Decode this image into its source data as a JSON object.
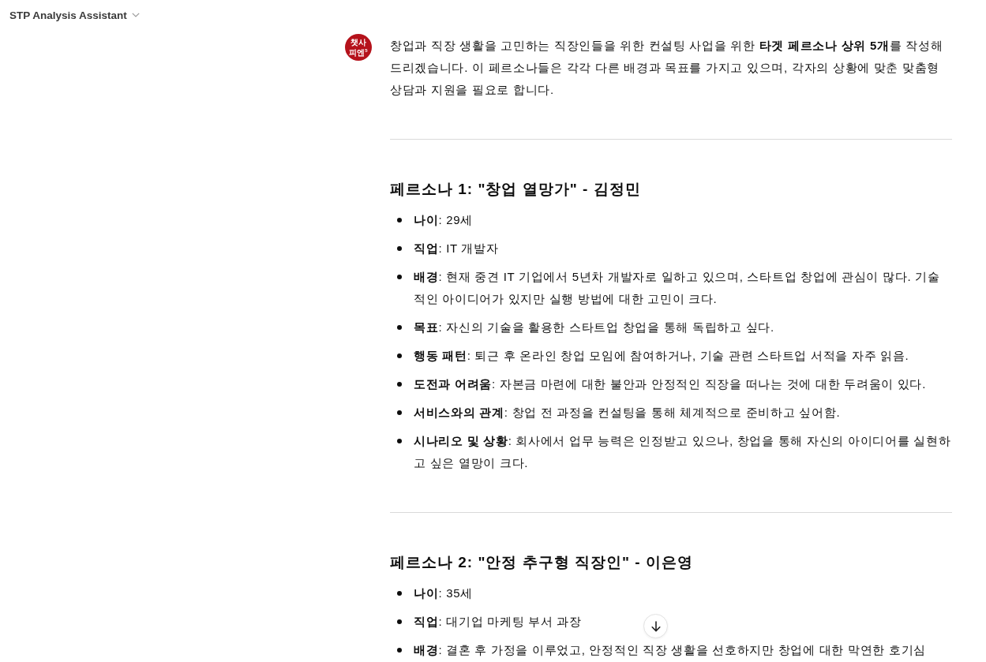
{
  "header": {
    "title": "STP Analysis Assistant"
  },
  "message": {
    "avatar": {
      "lines": [
        "챗사",
        "피엔$^{5}$"
      ]
    },
    "intro": "창업과 직장 생활을 고민하는 직장인들을 위한 컨설팅 사업을 위한 **타겟 페르소나 상위 5개**를 작성해 드리겠습니다. 이 페르소나들은 각각 다른 배경과 목표를 가지고 있으며, 각자의 상황에 맞춘 맞춤형 상담과 지원을 필요로 합니다.",
    "personas": [
      {
        "heading": "페르소나 1: \"창업 열망가\" - 김정민",
        "items": [
          "**나이**: 29세",
          "**직업**: IT 개발자",
          "**배경**: 현재 중견 IT 기업에서 5년차 개발자로 일하고 있으며, 스타트업 창업에 관심이 많다. 기술적인 아이디어가 있지만 실행 방법에 대한 고민이 크다.",
          "**목표**: 자신의 기술을 활용한 스타트업 창업을 통해 독립하고 싶다.",
          "**행동 패턴**: 퇴근 후 온라인 창업 모임에 참여하거나, 기술 관련 스타트업 서적을 자주 읽음.",
          "**도전과 어려움**: 자본금 마련에 대한 불안과 안정적인 직장을 떠나는 것에 대한 두려움이 있다.",
          "**서비스와의 관계**: 창업 전 과정을 컨설팅을 통해 체계적으로 준비하고 싶어함.",
          "**시나리오 및 상황**: 회사에서 업무 능력은 인정받고 있으나, 창업을 통해 자신의 아이디어를 실현하고 싶은 열망이 크다."
        ]
      },
      {
        "heading": "페르소나 2: \"안정 추구형 직장인\" - 이은영",
        "items": [
          "**나이**: 35세",
          "**직업**: 대기업 마케팅 부서 과장",
          "**배경**: 결혼 후 가정을 이루었고, 안정적인 직장 생활을 선호하지만 창업에 대한 막연한 호기심"
        ]
      }
    ]
  }
}
